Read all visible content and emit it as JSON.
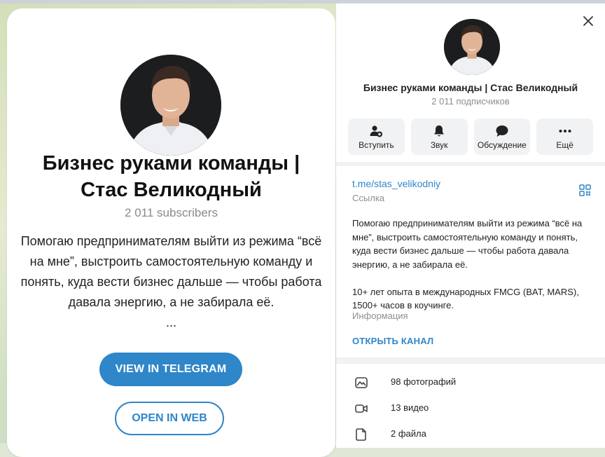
{
  "left_card": {
    "title": "Бизнес руками команды | Стас Великодный",
    "subscribers": "2 011 subscribers",
    "description": "Помогаю предпринимателям выйти из режима “всё на мне”, выстроить самостоятельную команду и понять, куда вести бизнес дальше — чтобы работа давала энергию, а не забирала её.",
    "ellipsis": "...",
    "view_button": "VIEW IN TELEGRAM",
    "web_button": "OPEN IN WEB"
  },
  "panel": {
    "title": "Бизнес руками команды | Стас Великодный",
    "subscribers": "2 011 подписчиков",
    "actions": [
      {
        "label": "Вступить",
        "icon": "join-icon"
      },
      {
        "label": "Звук",
        "icon": "bell-icon"
      },
      {
        "label": "Обсуждение",
        "icon": "chat-bubble-icon"
      },
      {
        "label": "Ещё",
        "icon": "more-dots-icon"
      }
    ],
    "link": "t.me/stas_velikodniy",
    "link_label": "Ссылка",
    "description_p1": "Помогаю предпринимателям выйти из режима “всё на мне”, выстроить самостоятельную команду и понять, куда вести бизнес дальше — чтобы работа давала энергию, а не забирала её.",
    "description_p2": "10+ лет опыта в международных FMCG (BAT, MARS), 1500+ часов в коучинге.",
    "info_label": "Информация",
    "open_channel": "ОТКРЫТЬ КАНАЛ",
    "media": [
      {
        "label": "98 фотографий",
        "icon": "photo-icon"
      },
      {
        "label": "13 видео",
        "icon": "video-icon"
      },
      {
        "label": "2 файла",
        "icon": "file-icon"
      }
    ]
  },
  "colors": {
    "accent": "#2f86c9",
    "muted": "#8b8f94"
  }
}
